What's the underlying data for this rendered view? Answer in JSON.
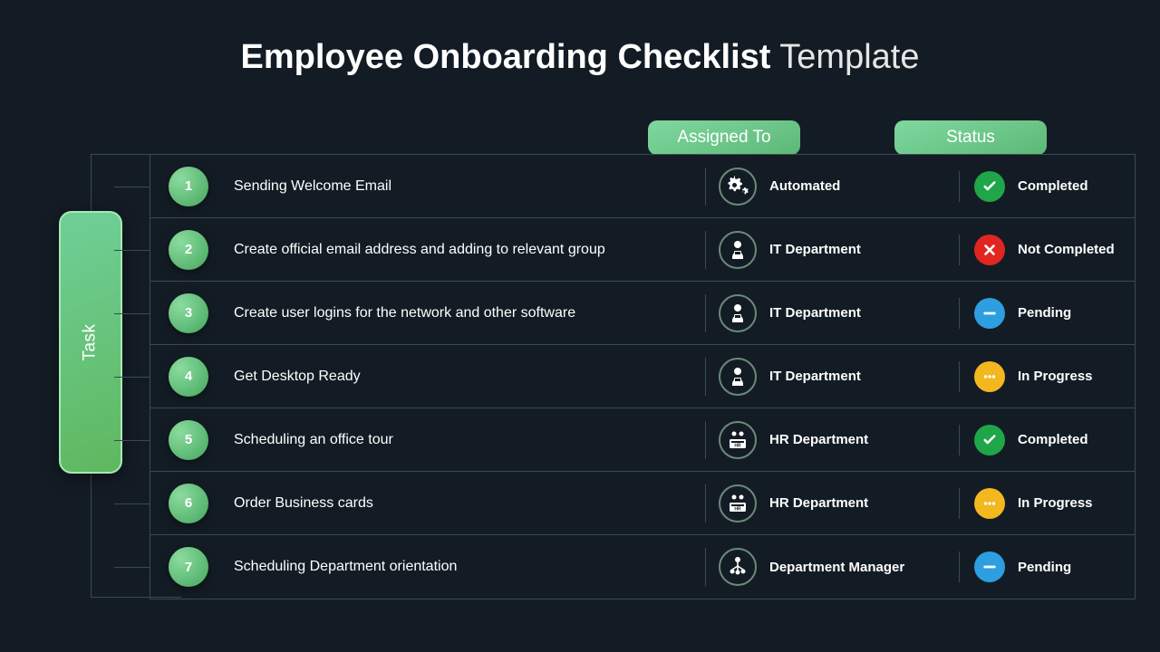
{
  "title_bold": "Employee Onboarding Checklist",
  "title_light": " Template",
  "task_label": "Task",
  "header_assigned": "Assigned To",
  "header_status": "Status",
  "rows": [
    {
      "num": "1",
      "task": "Sending Welcome Email",
      "assigned": "Automated",
      "assigned_icon": "gears",
      "status": "Completed",
      "status_type": "completed"
    },
    {
      "num": "2",
      "task": "Create official email address and adding to relevant group",
      "assigned": "IT Department",
      "assigned_icon": "it",
      "status": "Not Completed",
      "status_type": "notcompleted"
    },
    {
      "num": "3",
      "task": "Create user logins for the network and other software",
      "assigned": "IT Department",
      "assigned_icon": "it",
      "status": "Pending",
      "status_type": "pending"
    },
    {
      "num": "4",
      "task": "Get Desktop Ready",
      "assigned": "IT Department",
      "assigned_icon": "it",
      "status": "In Progress",
      "status_type": "inprogress"
    },
    {
      "num": "5",
      "task": "Scheduling an office tour",
      "assigned": "HR Department",
      "assigned_icon": "hr",
      "status": "Completed",
      "status_type": "completed"
    },
    {
      "num": "6",
      "task": "Order Business cards",
      "assigned": "HR Department",
      "assigned_icon": "hr",
      "status": "In Progress",
      "status_type": "inprogress"
    },
    {
      "num": "7",
      "task": "Scheduling Department orientation",
      "assigned": "Department Manager",
      "assigned_icon": "manager",
      "status": "Pending",
      "status_type": "pending"
    }
  ]
}
